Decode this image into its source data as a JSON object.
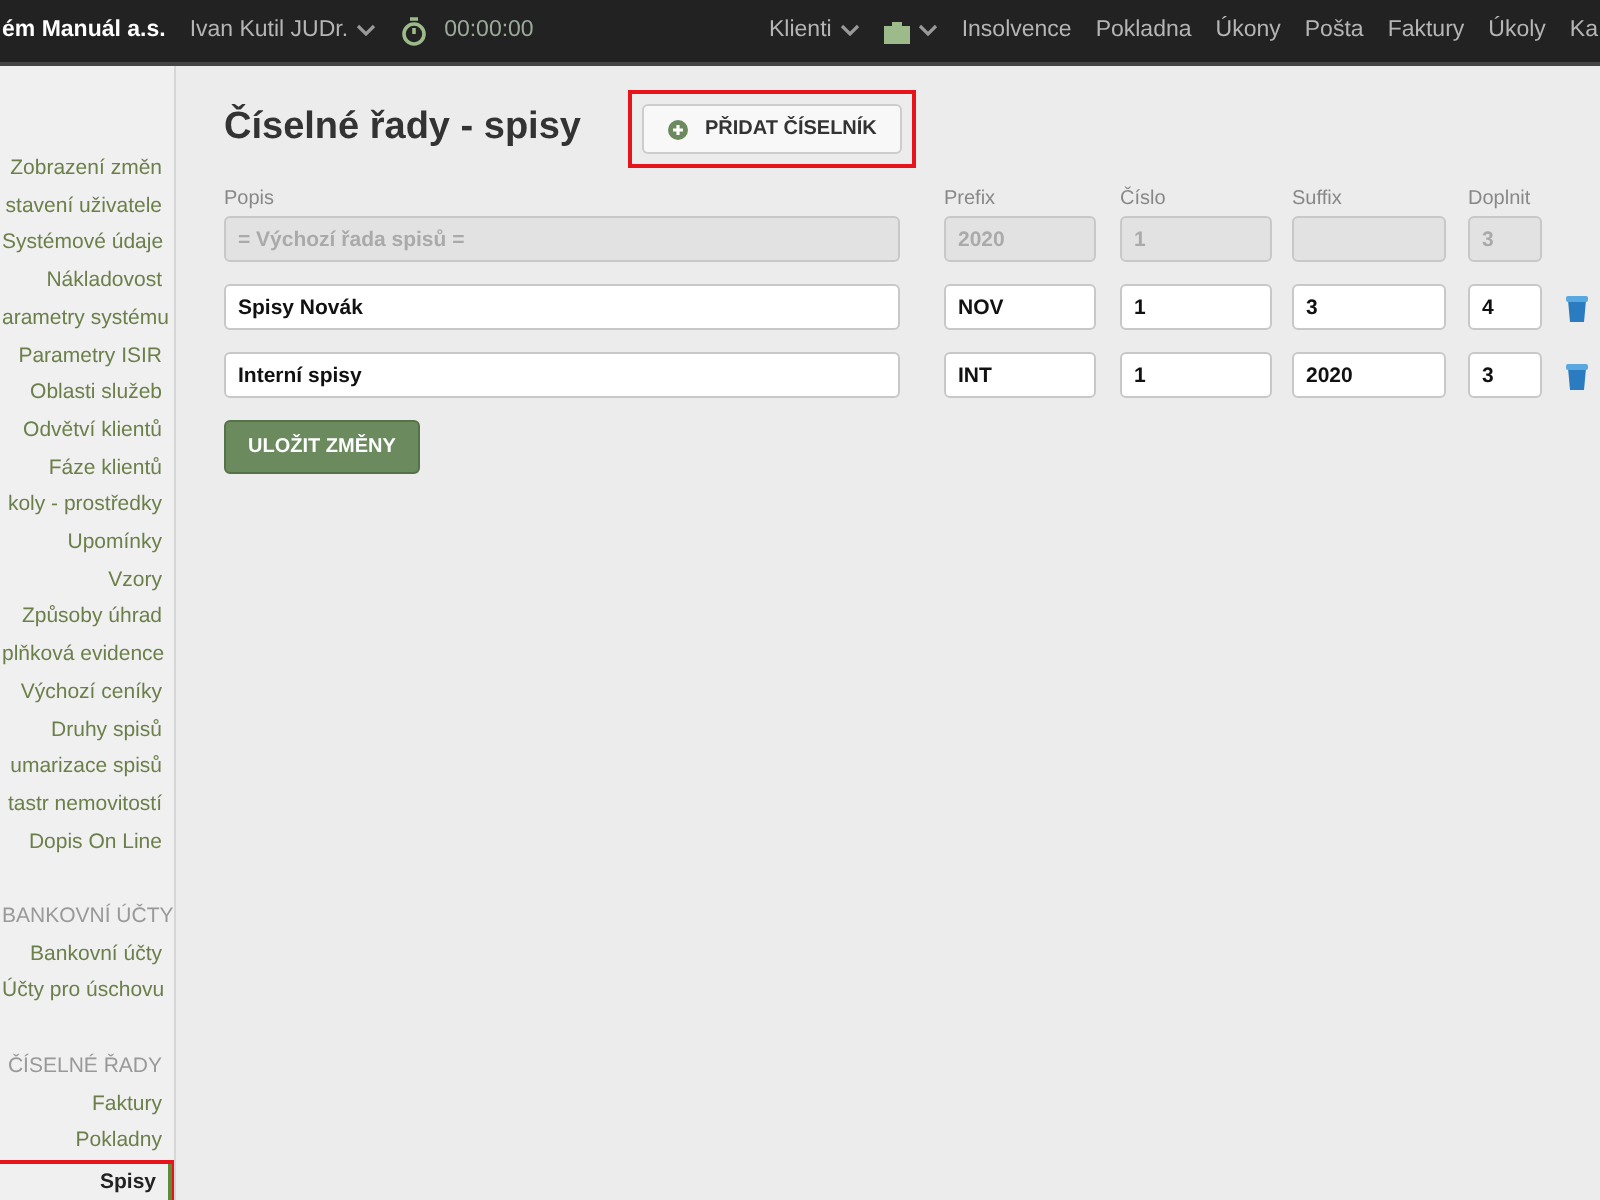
{
  "navbar": {
    "brand": "ém Manuál a.s.",
    "user": "Ivan Kutil JUDr.",
    "timer": "00:00:00",
    "menu": [
      {
        "kind": "dropdown",
        "label": "Klienti"
      },
      {
        "kind": "icon-dropdown"
      },
      {
        "kind": "link",
        "label": "Insolvence"
      },
      {
        "kind": "link",
        "label": "Pokladna"
      },
      {
        "kind": "link",
        "label": "Úkony"
      },
      {
        "kind": "link",
        "label": "Pošta"
      },
      {
        "kind": "link",
        "label": "Faktury"
      },
      {
        "kind": "link",
        "label": "Úkoly"
      },
      {
        "kind": "link",
        "label": "Ka"
      }
    ]
  },
  "sidebar": {
    "sections": [
      {
        "items": [
          {
            "label": "Zobrazení změn",
            "selected": false
          },
          {
            "label": "stavení uživatele",
            "selected": false
          },
          {
            "label": "Systémové údaje",
            "selected": false
          },
          {
            "label": "Nákladovost",
            "selected": false
          },
          {
            "label": "arametry systému",
            "selected": false
          },
          {
            "label": "Parametry ISIR",
            "selected": false
          },
          {
            "label": "Oblasti služeb",
            "selected": false
          },
          {
            "label": "Odvětví klientů",
            "selected": false
          },
          {
            "label": "Fáze klientů",
            "selected": false
          },
          {
            "label": "koly - prostředky",
            "selected": false
          },
          {
            "label": "Upomínky",
            "selected": false
          },
          {
            "label": "Vzory",
            "selected": false
          },
          {
            "label": "Způsoby úhrad",
            "selected": false
          },
          {
            "label": "plňková evidence",
            "selected": false
          },
          {
            "label": "Výchozí ceníky",
            "selected": false
          },
          {
            "label": "Druhy spisů",
            "selected": false
          },
          {
            "label": "umarizace spisů",
            "selected": false
          },
          {
            "label": "tastr nemovitostí",
            "selected": false
          },
          {
            "label": "Dopis On Line",
            "selected": false
          }
        ]
      },
      {
        "title": "BANKOVNÍ ÚČTY",
        "items": [
          {
            "label": "Bankovní účty",
            "selected": false
          },
          {
            "label": "Účty pro úschovu",
            "selected": false
          }
        ]
      },
      {
        "title": "ČÍSELNÉ ŘADY",
        "items": [
          {
            "label": "Faktury",
            "selected": false
          },
          {
            "label": "Pokladny",
            "selected": false
          },
          {
            "label": "Spisy",
            "selected": true,
            "highlighted": true
          }
        ]
      }
    ]
  },
  "page": {
    "title": "Číselné řady - spisy",
    "add_button": {
      "label": "PŘIDAT ČÍSELNÍK",
      "highlighted": true
    },
    "columns": [
      "Popis",
      "Prefix",
      "Číslo",
      "Suffix",
      "Doplnit"
    ],
    "rows": [
      {
        "disabled": true,
        "popis": "= Výchozí řada spisů =",
        "prefix": "2020",
        "cislo": "1",
        "suffix": "",
        "doplnit": "3"
      },
      {
        "disabled": false,
        "popis": "Spisy Novák",
        "prefix": "NOV",
        "cislo": "1",
        "suffix": "3",
        "doplnit": "4"
      },
      {
        "disabled": false,
        "popis": "Interní spisy",
        "prefix": "INT",
        "cislo": "1",
        "suffix": "2020",
        "doplnit": "3"
      }
    ],
    "save_button": "ULOŽIT ZMĚNY"
  }
}
